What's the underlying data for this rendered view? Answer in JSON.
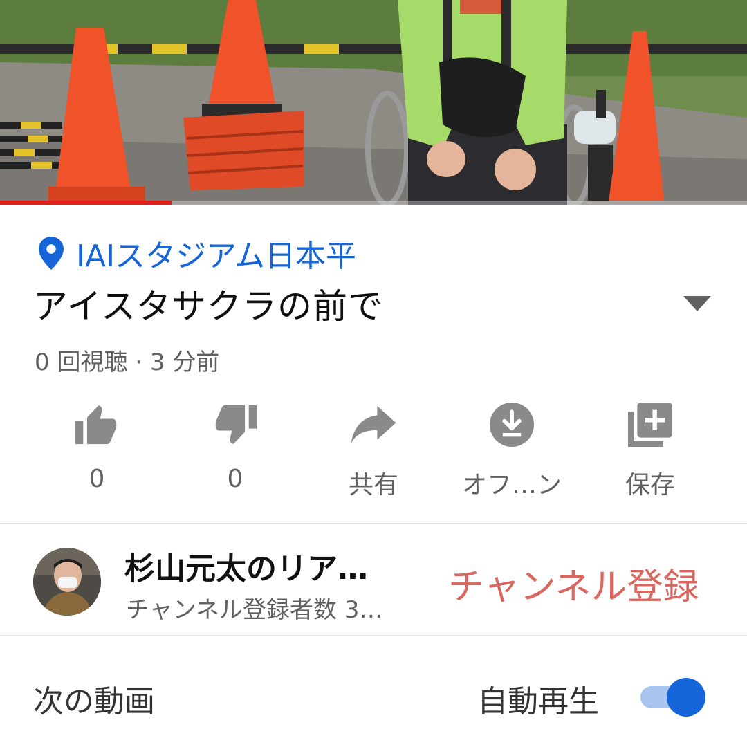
{
  "video": {
    "progress_fraction": 0.23
  },
  "info": {
    "location": "IAIスタジアム日本平",
    "title": "アイスタサクラの前で",
    "meta": "0 回視聴 · 3 分前"
  },
  "actions": [
    {
      "icon": "thumbs-up-icon",
      "label": "0"
    },
    {
      "icon": "thumbs-down-icon",
      "label": "0"
    },
    {
      "icon": "share-icon",
      "label": "共有"
    },
    {
      "icon": "download-icon",
      "label": "オフ…ン"
    },
    {
      "icon": "save-to-playlist-icon",
      "label": "保存"
    }
  ],
  "channel": {
    "name": "杉山元太のリア…",
    "subscribers": "チャンネル登録者数 3…",
    "subscribe_label": "チャンネル登録"
  },
  "next": {
    "label": "次の動画",
    "autoplay_label": "自動再生",
    "autoplay_on": true
  },
  "colors": {
    "link_blue": "#1565d8",
    "subscribe": "#d9675f",
    "progress_red": "#e0201a",
    "icon_gray": "#8a8a8a"
  }
}
